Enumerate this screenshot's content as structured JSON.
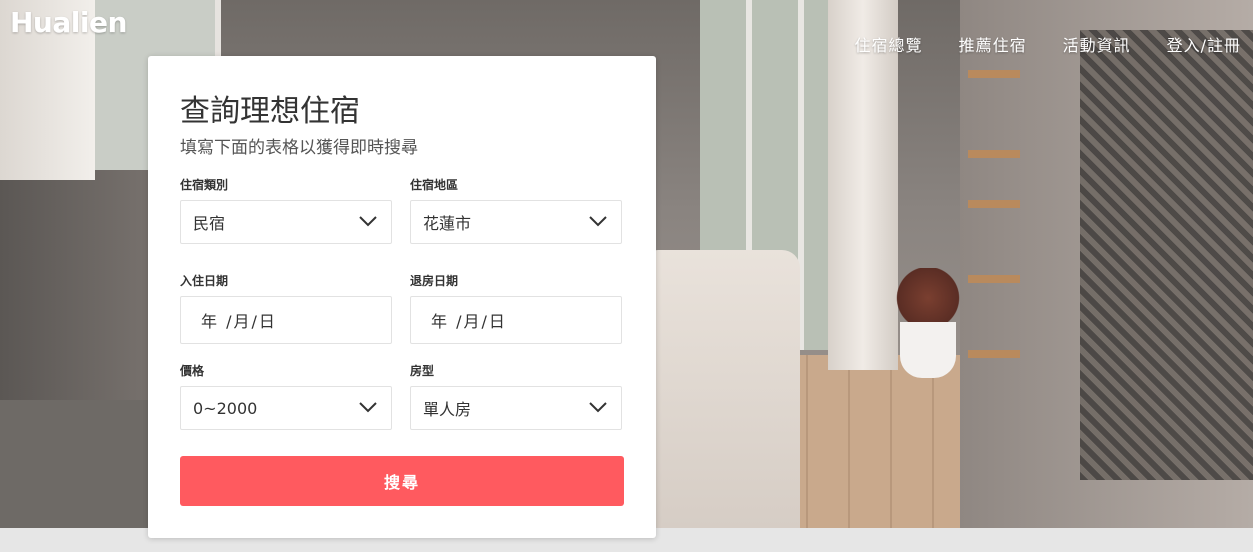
{
  "brand": {
    "logo_text": "Hualien"
  },
  "nav": {
    "items": [
      {
        "label": "住宿總覽"
      },
      {
        "label": "推薦住宿"
      },
      {
        "label": "活動資訊"
      },
      {
        "label": "登入/註冊"
      }
    ]
  },
  "search_form": {
    "title": "查詢理想住宿",
    "subtitle": "填寫下面的表格以獲得即時搜尋",
    "lodging_type": {
      "label": "住宿類別",
      "value": "民宿"
    },
    "area": {
      "label": "住宿地區",
      "value": "花蓮市"
    },
    "check_in": {
      "label": "入住日期",
      "value": "年 /月/日"
    },
    "check_out": {
      "label": "退房日期",
      "value": "年 /月/日"
    },
    "price": {
      "label": "價格",
      "value": "0~2000"
    },
    "room_type": {
      "label": "房型",
      "value": "單人房"
    },
    "submit_label": "搜尋"
  },
  "colors": {
    "accent": "#ff5a5f",
    "card_bg": "#ffffff",
    "footer_bar": "#e6e6e6"
  }
}
